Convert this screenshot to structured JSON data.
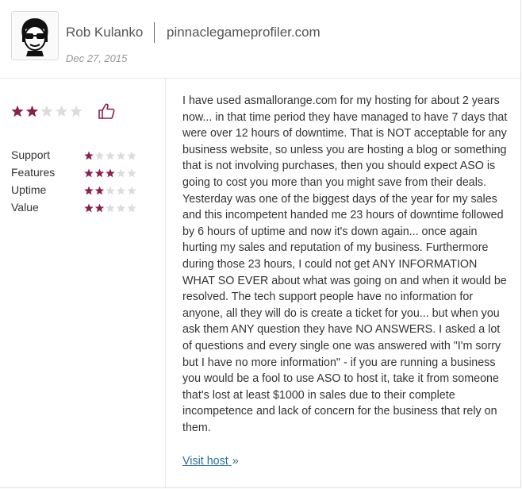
{
  "reviewer": {
    "name": "Rob Kulanko",
    "site": "pinnaclegameprofiler.com",
    "date": "Dec 27, 2015",
    "avatar_icon": "sunglasses-face-icon"
  },
  "overall": {
    "rating": 2,
    "max": 5,
    "thumb_icon": "thumbs-up-icon",
    "filled_color": "#8b1f4f",
    "empty_color": "#dcdcdc"
  },
  "categories": [
    {
      "label": "Support",
      "rating": 1
    },
    {
      "label": "Features",
      "rating": 3
    },
    {
      "label": "Uptime",
      "rating": 2
    },
    {
      "label": "Value",
      "rating": 2
    }
  ],
  "review_text": "I have used asmallorange.com for my hosting for about 2 years now... in that time period they have managed to have 7 days that were over 12 hours of downtime. That is NOT acceptable for any business website, so unless you are hosting a blog or something that is not involving purchases, then you should expect ASO is going to cost you more than you might save from their deals. Yesterday was one of the biggest days of the year for my sales and this incompetent handed me 23 hours of downtime followed by 6 hours of uptime and now it's down again... once again hurting my sales and reputation of my business. Furthermore during those 23 hours, I could not get ANY INFORMATION WHAT SO EVER about what was going on and when it would be resolved. The tech support people have no information for anyone, all they will do is create a ticket for you... but when you ask them ANY question they have NO ANSWERS. I asked a lot of questions and every single one was answered with \"I'm sorry but I have no more information\" - if you are running a business you would be a fool to use ASO to host it, take it from someone that's lost at least $1000 in sales due to their complete incompetence and lack of concern for the business that rely on them.",
  "visit_link": {
    "label": "Visit host",
    "arrow": "»",
    "color": "#2a6f9e"
  }
}
